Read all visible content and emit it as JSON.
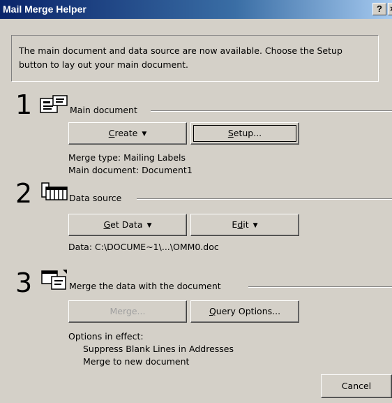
{
  "window": {
    "title": "Mail Merge Helper",
    "help_label": "?",
    "close_label": "×"
  },
  "intro_text": "The main document and data source are now available. Choose the Setup button to lay out your main document.",
  "steps": [
    {
      "number": "1",
      "icon": "main-document-icon",
      "group_label": "Main document",
      "buttons": {
        "create": {
          "pre": "",
          "u": "C",
          "post": "reate",
          "caret": "▼"
        },
        "setup": {
          "pre": "",
          "u": "S",
          "post": "etup..."
        }
      },
      "info": [
        "Merge type: Mailing Labels",
        "Main document: Document1"
      ]
    },
    {
      "number": "2",
      "icon": "data-source-icon",
      "group_label": "Data source",
      "buttons": {
        "get_data": {
          "pre": "",
          "u": "G",
          "post": "et Data",
          "caret": "▼"
        },
        "edit": {
          "pre": "E",
          "u": "d",
          "post": "it",
          "caret": "▼"
        }
      },
      "info": [
        "Data: C:\\DOCUME~1\\...\\OMM0.doc"
      ]
    },
    {
      "number": "3",
      "icon": "merge-icon",
      "group_label": "Merge the data with the document",
      "buttons": {
        "merge": {
          "label": "Merge..."
        },
        "query": {
          "pre": "",
          "u": "Q",
          "post": "uery Options..."
        }
      },
      "info": [
        "Options in effect:",
        "Suppress Blank Lines in Addresses",
        "Merge to new document"
      ]
    }
  ],
  "cancel_label": "Cancel",
  "colors": {
    "title_bar_start": "#0a246a",
    "title_bar_end": "#a6caf0",
    "face": "#d4d0c8"
  }
}
